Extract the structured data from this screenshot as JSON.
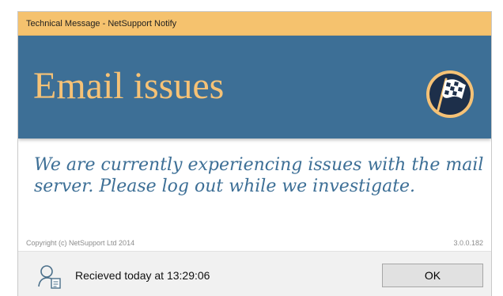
{
  "window": {
    "title": "Technical Message - NetSupport Notify"
  },
  "banner": {
    "heading": "Email issues",
    "icon": "checkered-flag-icon",
    "background_color": "#3d6f96",
    "heading_color": "#f6c276"
  },
  "message": {
    "body": "We are currently experiencing issues with the mail server. Please log out while we investigate."
  },
  "meta": {
    "copyright": "Copyright (c) NetSupport Ltd 2014",
    "version": "3.0.0.182"
  },
  "footer": {
    "received": "Recieved today at 13:29:06",
    "user_icon": "user-message-icon",
    "ok_label": "OK"
  },
  "colors": {
    "titlebar": "#f5c26e",
    "message_text": "#3d6f96"
  }
}
